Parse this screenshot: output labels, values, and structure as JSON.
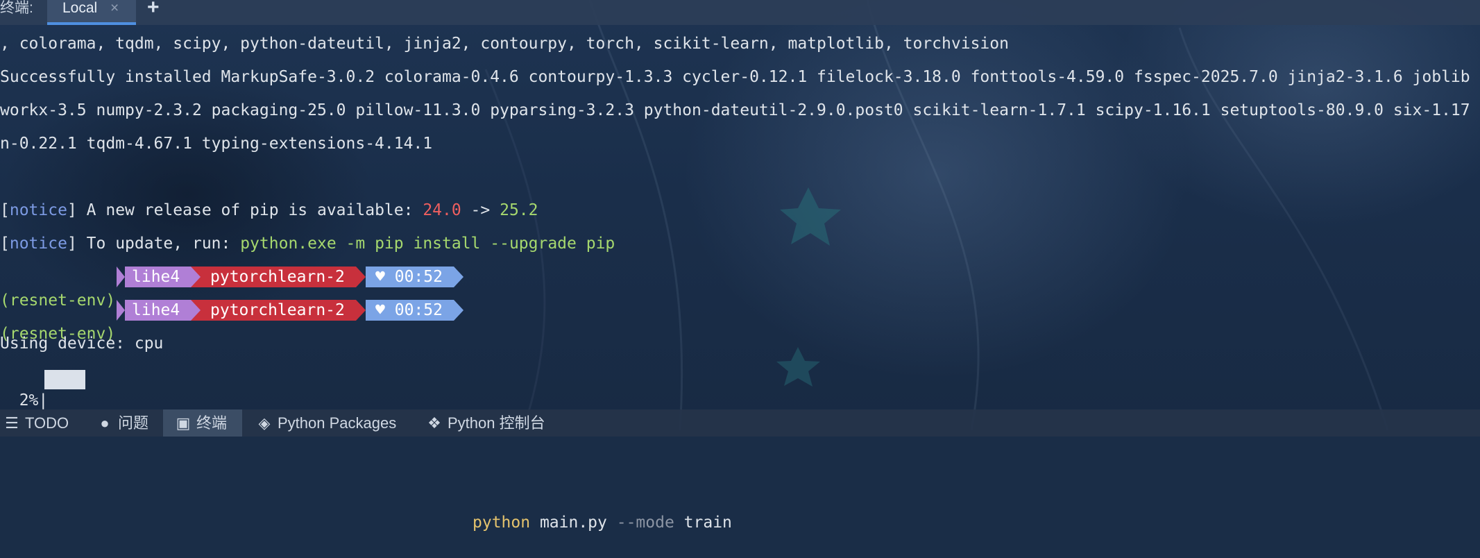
{
  "tabbar": {
    "title": "终端:",
    "tab_label": "Local",
    "close_glyph": "×",
    "add_glyph": "+"
  },
  "terminal": {
    "line1": ", colorama, tqdm, scipy, python-dateutil, jinja2, contourpy, torch, scikit-learn, matplotlib, torchvision",
    "line2": "Successfully installed MarkupSafe-3.0.2 colorama-0.4.6 contourpy-1.3.3 cycler-0.12.1 filelock-3.18.0 fonttools-4.59.0 fsspec-2025.7.0 jinja2-3.1.6 joblib",
    "line3": "workx-3.5 numpy-2.3.2 packaging-25.0 pillow-11.3.0 pyparsing-3.2.3 python-dateutil-2.9.0.post0 scikit-learn-1.7.1 scipy-1.16.1 setuptools-80.9.0 six-1.17",
    "line4": "n-0.22.1 tqdm-4.67.1 typing-extensions-4.14.1",
    "notice1": {
      "bracket_open": "[",
      "tag": "notice",
      "bracket_close": "]",
      "text": " A new release of pip is available: ",
      "old_version": "24.0",
      "arrow": " -> ",
      "new_version": "25.2"
    },
    "notice2": {
      "bracket_open": "[",
      "tag": "notice",
      "bracket_close": "]",
      "text": " To update, run: ",
      "command": "python.exe -m pip install --upgrade pip"
    },
    "prompt": {
      "env": "(resnet-env)",
      "user": "lihe4",
      "dir": "pytorchlearn-2",
      "heart": "♥",
      "time": "00:52"
    },
    "command": {
      "program": "python",
      "script": " main.py ",
      "flag": "--mode",
      "value": " train"
    },
    "device_line": "Using device: cpu",
    "progress": {
      "percent_text": "  2%|",
      "fraction": 0.02
    }
  },
  "toolbar": {
    "items": [
      {
        "label": "TODO",
        "icon": "list-icon"
      },
      {
        "label": "问题",
        "icon": "alert-icon"
      },
      {
        "label": "终端",
        "icon": "terminal-icon"
      },
      {
        "label": "Python Packages",
        "icon": "layers-icon"
      },
      {
        "label": "Python 控制台",
        "icon": "python-icon"
      }
    ]
  },
  "colors": {
    "accent": "#4f8fe0",
    "user_segment": "#b07fd6",
    "dir_segment": "#c8303c",
    "time_segment": "#7ba4e6",
    "notice": "#7d9be4",
    "red": "#ef5f5f",
    "green": "#a6d86e",
    "yellow": "#e5c36d"
  }
}
